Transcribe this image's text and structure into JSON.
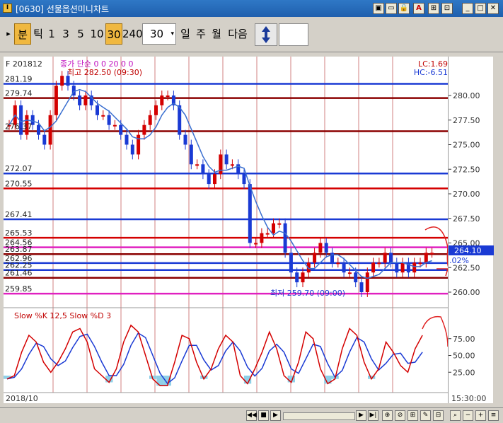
{
  "window": {
    "title": "[0630] 선물옵션미니차트",
    "icon_label": "I"
  },
  "toolbar": {
    "arrow": "▸",
    "buttons": [
      "분",
      "틱",
      "1",
      "3",
      "5",
      "10",
      "30",
      "240"
    ],
    "active_button": "30",
    "interval_value": "30",
    "period_buttons": [
      "일",
      "주",
      "월",
      "다음"
    ]
  },
  "chart": {
    "header_left": "F 201812",
    "header_close": "종가 단순 0 0 20 0 0",
    "header_high": "최고 282.50 (09:30)",
    "lc": "LC:1.69",
    "hc": "HC:-6.51",
    "low_marker": "최저 259.70 (09:00)",
    "current_price": "264.10",
    "current_pct": "-1.02%",
    "left_levels": [
      "281.19",
      "279.74",
      "276.37",
      "272.07",
      "270.55",
      "267.41",
      "265.53",
      "264.56",
      "263.87",
      "262.96",
      "262.25",
      "261.46",
      "259.85"
    ],
    "right_ticks": [
      "280.00",
      "277.50",
      "275.00",
      "272.50",
      "270.00",
      "267.50",
      "265.00",
      "262.50",
      "260.00"
    ],
    "stoch_label": "Slow %K 12,5  Slow %D 3",
    "stoch_ticks": [
      "75.00",
      "50.00",
      "25.00"
    ],
    "date_left": "2018/10",
    "time_right": "15:30:00"
  },
  "colors": {
    "up": "#d40000",
    "down": "#1a3ad4",
    "ma": "#3a6fd0",
    "magenta": "#e020c0",
    "grid": "#c04040"
  }
}
